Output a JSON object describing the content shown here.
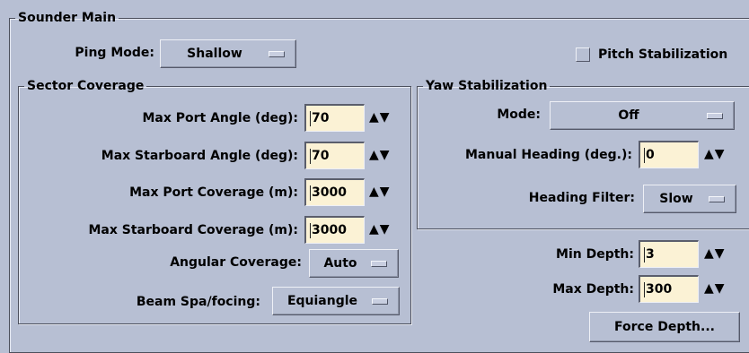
{
  "sounder_main": {
    "title": "Sounder Main",
    "ping_mode_label": "Ping Mode:",
    "ping_mode_value": "Shallow",
    "pitch_stabilization_label": "Pitch Stabilization",
    "pitch_stabilization_checked": false
  },
  "sector_coverage": {
    "title": "Sector Coverage",
    "max_port_angle_label": "Max Port Angle (deg):",
    "max_port_angle_value": "70",
    "max_starboard_angle_label": "Max Starboard Angle (deg):",
    "max_starboard_angle_value": "70",
    "max_port_coverage_label": "Max Port Coverage (m):",
    "max_port_coverage_value": "3000",
    "max_starboard_coverage_label": "Max Starboard Coverage (m):",
    "max_starboard_coverage_value": "3000",
    "angular_coverage_label": "Angular Coverage:",
    "angular_coverage_value": "Auto",
    "beam_spacing_label": "Beam Spa/focing:",
    "beam_spacing_value": "Equiangle"
  },
  "yaw_stabilization": {
    "title": "Yaw Stabilization",
    "mode_label": "Mode:",
    "mode_value": "Off",
    "manual_heading_label": "Manual Heading (deg.):",
    "manual_heading_value": "0",
    "heading_filter_label": "Heading Filter:",
    "heading_filter_value": "Slow"
  },
  "depth": {
    "min_depth_label": "Min Depth:",
    "min_depth_value": "3",
    "max_depth_label": "Max Depth:",
    "max_depth_value": "300",
    "force_depth_label": "Force Depth..."
  },
  "icons": {
    "spin_arrows": "▲▼"
  }
}
